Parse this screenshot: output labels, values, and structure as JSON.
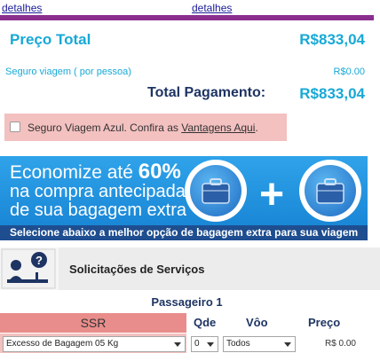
{
  "links": {
    "left": "detalhes",
    "right": "detalhes"
  },
  "pricing": {
    "preco_total_label": "Preço Total",
    "preco_total_value": "R$833,04",
    "seguro_label": "Seguro viagem ( por pessoa)",
    "seguro_value": "R$0.00",
    "total_label": "Total Pagamento:",
    "total_value": "R$833,04"
  },
  "insurance": {
    "text": "Seguro Viagem Azul. Confira as ",
    "link": "Vantagens Aqui",
    "suffix": ".",
    "checked": false
  },
  "banner": {
    "line1_prefix": "Economize até ",
    "line1_percent": "60%",
    "line2": "na compra antecipada",
    "line3": "de sua bagagem extra",
    "bottom": "Selecione abaixo a melhor opção de bagagem extra para sua viagem"
  },
  "services": {
    "title": "Solicitações de Serviços"
  },
  "passenger": {
    "title": "Passageiro  1",
    "headers": {
      "ssr": "SSR",
      "qde": "Qde",
      "voo": "Vôo",
      "preco": "Preço"
    },
    "row": {
      "ssr": "Excesso de Bagagem 05 Kg",
      "qde": "0",
      "voo": "Todos",
      "preco": "R$ 0.00"
    }
  },
  "colors": {
    "accent": "#17a9d6",
    "navy": "#1e3463",
    "purple": "#8b2f8f",
    "pink": "#f3c1c0",
    "banner_blue": "#1d7fd2"
  }
}
